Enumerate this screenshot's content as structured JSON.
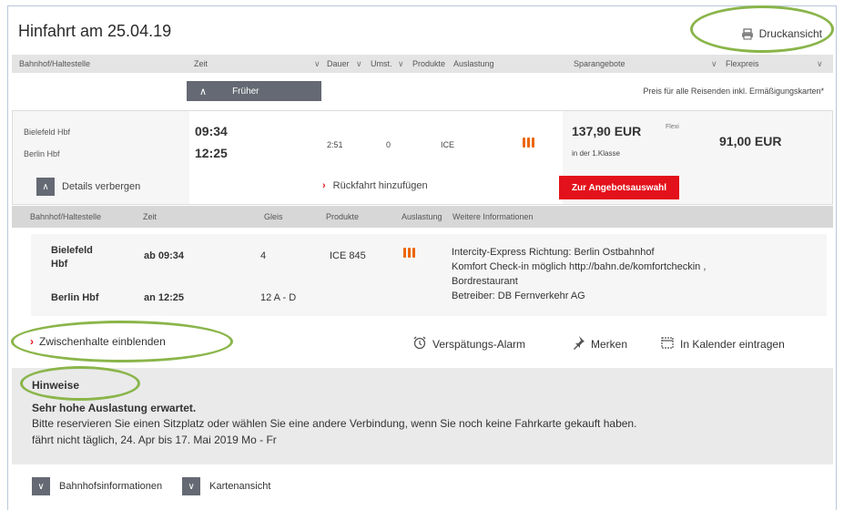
{
  "header": {
    "title": "Hinfahrt am 25.04.19",
    "print_label": "Druckansicht"
  },
  "columns": {
    "station": "Bahnhof/Haltestelle",
    "time": "Zeit",
    "duration": "Dauer",
    "changes": "Umst.",
    "products": "Produkte",
    "occupancy": "Auslastung",
    "offers": "Sparangebote",
    "flex": "Flexpreis"
  },
  "earlier_label": "Früher",
  "price_note": "Preis für alle Reisenden inkl. Ermäßigungskarten*",
  "connection": {
    "from": "Bielefeld Hbf",
    "to": "Berlin Hbf",
    "dep": "09:34",
    "arr": "12:25",
    "duration": "2:51",
    "changes": "0",
    "product": "ICE",
    "saver_price": "137,90 EUR",
    "saver_class": "in der 1.Klasse",
    "saver_tag": "Flexi",
    "flex_price": "91,00 EUR",
    "details_label": "Details verbergen",
    "return_label": "Rückfahrt hinzufügen",
    "offer_label": "Zur Angebotsauswahl"
  },
  "detail_columns": {
    "station": "Bahnhof/Haltestelle",
    "time": "Zeit",
    "track": "Gleis",
    "products": "Produkte",
    "occupancy": "Auslastung",
    "info": "Weitere Informationen"
  },
  "detail": {
    "dep_station_line1": "Bielefeld",
    "dep_station_line2": "Hbf",
    "dep_time": "ab 09:34",
    "dep_track": "4",
    "train": "ICE 845",
    "arr_station": "Berlin Hbf",
    "arr_time": "an 12:25",
    "arr_track": "12 A - D",
    "info1": "Intercity-Express Richtung: Berlin Ostbahnhof",
    "info2": "Komfort Check-in möglich http://bahn.de/komfortcheckin ,",
    "info3": "Bordrestaurant",
    "info4": "Betreiber: DB Fernverkehr AG"
  },
  "actions": {
    "stops": "Zwischenhalte einblenden",
    "delay_alarm": "Verspätungs-Alarm",
    "remember": "Merken",
    "calendar": "In Kalender eintragen"
  },
  "notes": {
    "heading": "Hinweise",
    "line1": "Sehr hohe Auslastung erwartet.",
    "line2": "Bitte reservieren Sie einen Sitzplatz oder wählen Sie eine andere Verbindung, wenn Sie noch keine Fahrkarte gekauft haben.",
    "line3": "fährt nicht täglich, 24. Apr bis 17. Mai 2019 Mo - Fr"
  },
  "bottom": {
    "station_info": "Bahnhofsinformationen",
    "map": "Kartenansicht"
  },
  "colors": {
    "accent_red": "#e3111b",
    "occupancy_orange": "#ec6608",
    "highlight_ring": "#8ab54a"
  }
}
